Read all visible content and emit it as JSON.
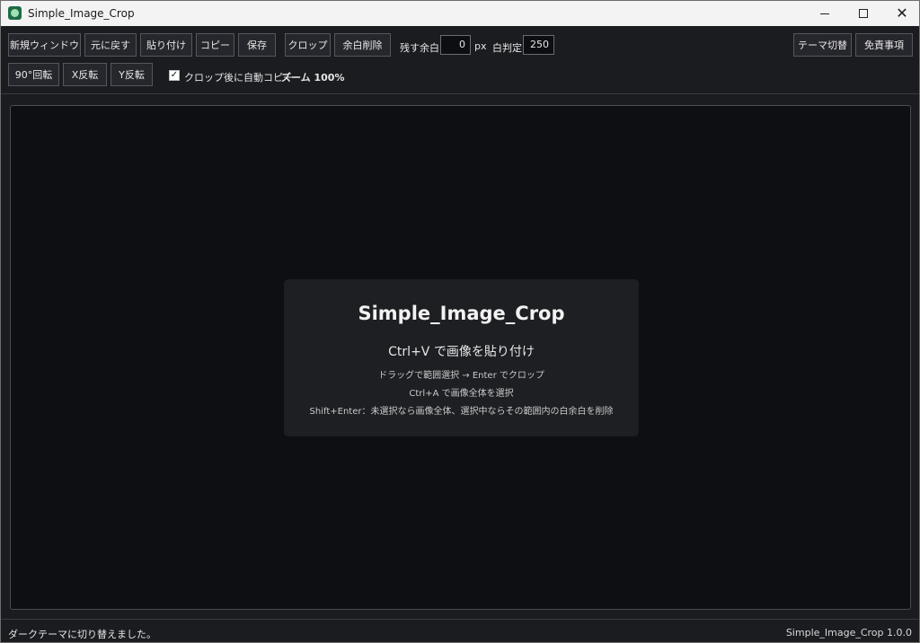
{
  "window": {
    "title": "Simple_Image_Crop",
    "controls": {
      "minimize": "minimize",
      "maximize": "maximize",
      "close": "✕"
    }
  },
  "toolbar": {
    "row1": {
      "new_window": "新規ウィンドウ",
      "undo": "元に戻す",
      "paste": "貼り付け",
      "copy": "コピー",
      "save": "保存",
      "crop": "クロップ",
      "remove_margin": "余白削除",
      "margin_label": "残す余白",
      "margin_value": "0",
      "margin_unit": "px",
      "white_threshold_label": "白判定",
      "white_threshold_value": "250",
      "theme_toggle": "テーマ切替",
      "disclaimer": "免責事項"
    },
    "row2": {
      "rotate90": "90°回転",
      "flip_x": "X反転",
      "flip_y": "Y反転",
      "auto_copy_checked": true,
      "auto_copy_label": "クロップ後に自動コピー",
      "zoom_text": "ズーム 100%"
    }
  },
  "welcome": {
    "title": "Simple_Image_Crop",
    "subtitle": "Ctrl+V で画像を貼り付け",
    "lines": [
      "ドラッグで範囲選択 → Enter でクロップ",
      "Ctrl+A で画像全体を選択",
      "Shift+Enter：未選択なら画像全体、選択中ならその範囲内の白余白を削除"
    ]
  },
  "status": {
    "message": "ダークテーマに切り替えました。",
    "version": "Simple_Image_Crop 1.0.0"
  },
  "colors": {
    "background": "#1b1c20",
    "canvas": "#0e0f12",
    "panel": "#1e1f23",
    "button": "#26272c",
    "text": "#e6e6e6"
  }
}
